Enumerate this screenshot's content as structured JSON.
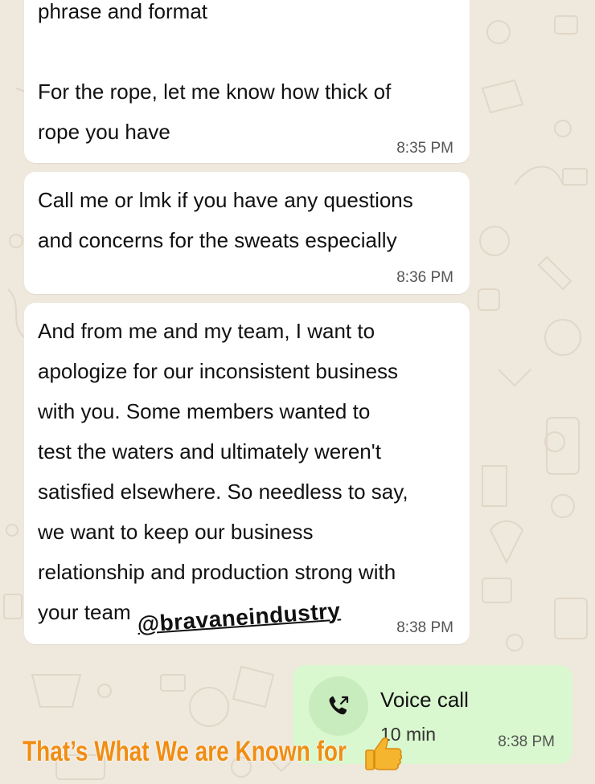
{
  "messages": [
    {
      "text": "phrase and format\n\nFor the rope, let me know how thick of\nrope you have",
      "time": "8:35 PM"
    },
    {
      "text": "Call me or lmk if you have any questions\nand concerns for the sweats especially",
      "time": "8:36 PM"
    },
    {
      "text": "And from me and my team, I want to\napologize for our inconsistent business\nwith you. Some members wanted to\ntest the waters and ultimately weren't\nsatisfied elsewhere. So needless to say,\nwe want to keep our business\nrelationship and production strong with\nyour team",
      "time": "8:38 PM"
    }
  ],
  "watermark": "@bravaneindustry",
  "voice_call": {
    "title": "Voice call",
    "duration": "10 min",
    "time": "8:38 PM",
    "icon": "outgoing-call-icon"
  },
  "tagline": "That’s What We are Known for",
  "tagline_emoji": "thumbs-up-icon",
  "colors": {
    "background": "#efe8dc",
    "bubble_in": "#ffffff",
    "bubble_out": "#d9f8cf",
    "tagline": "#f08d12"
  }
}
